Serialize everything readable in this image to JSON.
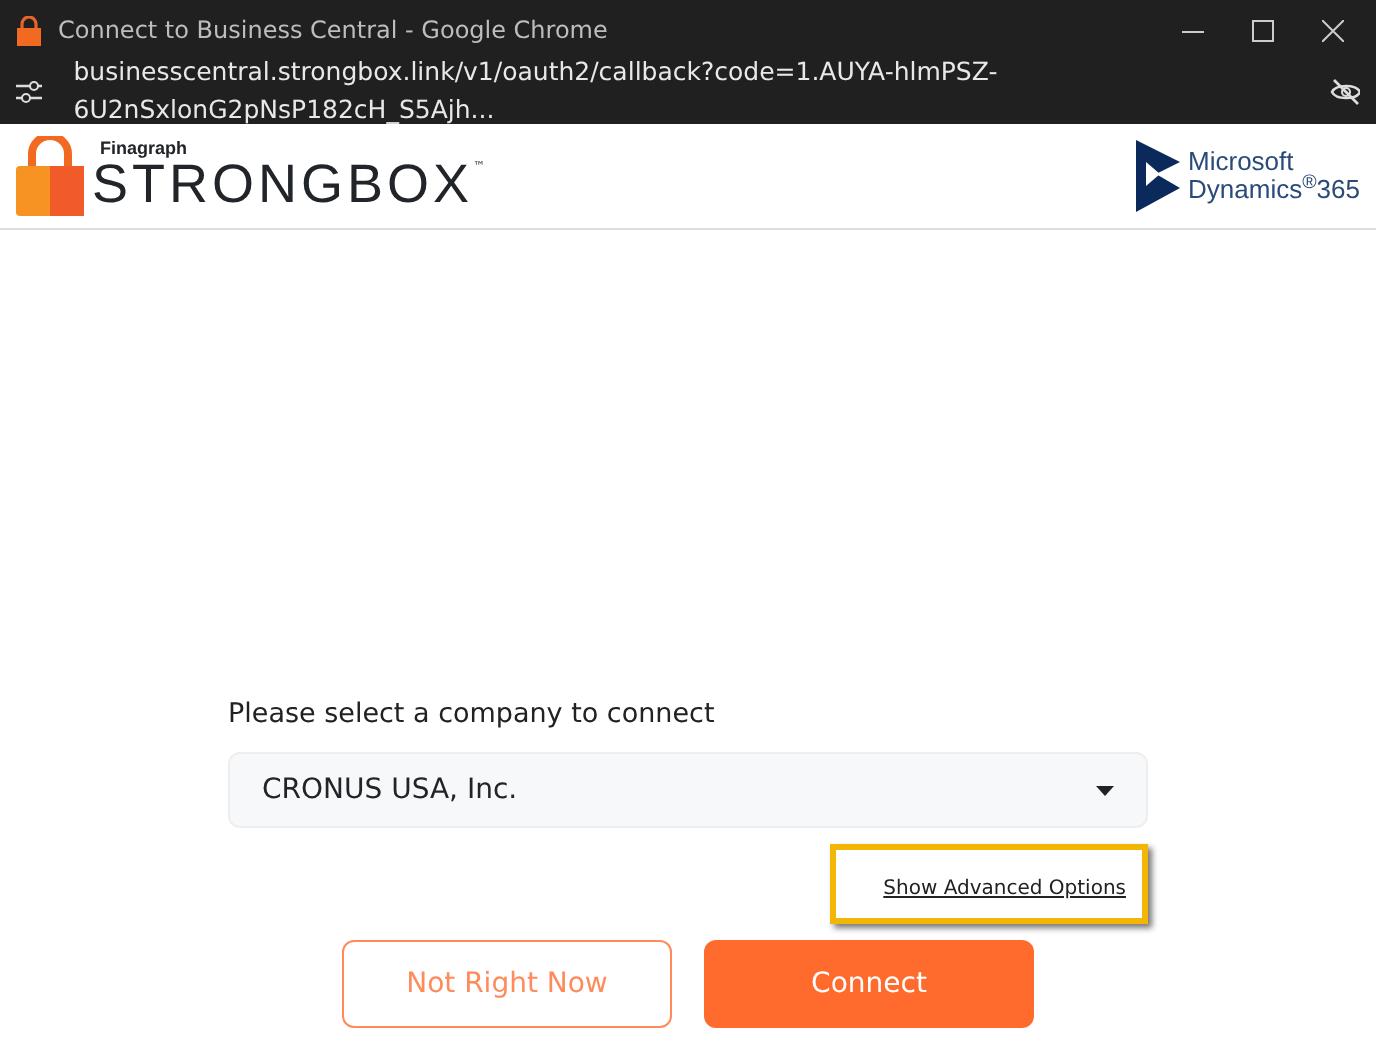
{
  "window": {
    "title": "Connect to Business Central - Google Chrome"
  },
  "address_bar": {
    "url": "businesscentral.strongbox.link/v1/oauth2/callback?code=1.AUYA-hlmPSZ-6U2nSxlonG2pNsP182cH_S5Ajh..."
  },
  "header": {
    "brand_small": "Finagraph",
    "brand": "STRONGBOX",
    "trademark": "™",
    "partner_line1": "Microsoft",
    "partner_line2": "Dynamics$^{®}$365"
  },
  "form": {
    "label": "Please select a company to connect",
    "company": "CRONUS USA, Inc.",
    "advanced_link": {
      "text": "Show Advanced Options",
      "highlighted": true
    }
  },
  "buttons": [
    {
      "label": "Not Right Now",
      "kind": "outline"
    },
    {
      "label": "Connect",
      "kind": "primary"
    }
  ]
}
